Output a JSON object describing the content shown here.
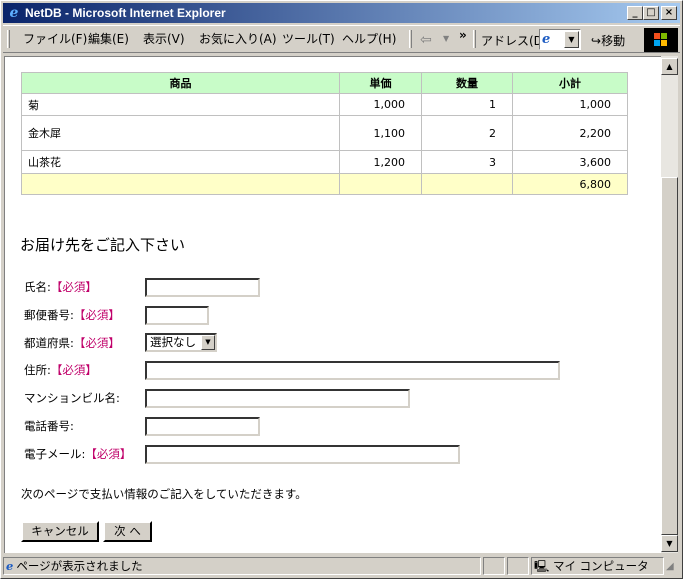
{
  "window": {
    "title": "NetDB - Microsoft Internet Explorer"
  },
  "menu": {
    "items": [
      "ファイル(F)",
      "編集(E)",
      "表示(V)",
      "お気に入り(A)",
      "ツール(T)",
      "ヘルプ(H)"
    ],
    "address_label": "アドレス(D)",
    "go_label": "移動"
  },
  "order_table": {
    "headers": [
      "商品",
      "単価",
      "数量",
      "小計"
    ],
    "rows": [
      {
        "product": "菊",
        "price": "1,000",
        "qty": "1",
        "subtotal": "1,000"
      },
      {
        "product": "金木犀",
        "price": "1,100",
        "qty": "2",
        "subtotal": "2,200"
      },
      {
        "product": "山茶花",
        "price": "1,200",
        "qty": "3",
        "subtotal": "3,600"
      }
    ],
    "total": "6,800"
  },
  "form": {
    "title": "お届け先をご記入下さい",
    "required_mark": "【必須】",
    "labels": {
      "name": "氏名:",
      "postal": "郵便番号:",
      "prefecture": "都道府県:",
      "address": "住所:",
      "building": "マンションビル名:",
      "phone": "電話番号:",
      "email": "電子メール:"
    },
    "prefecture_selected": "選択なし",
    "note": "次のページで支払い情報のご記入をしていただきます。",
    "cancel_label": "キャンセル",
    "next_label": "次 へ"
  },
  "statusbar": {
    "message": "ページが表示されました",
    "zone": "マイ コンピュータ"
  }
}
